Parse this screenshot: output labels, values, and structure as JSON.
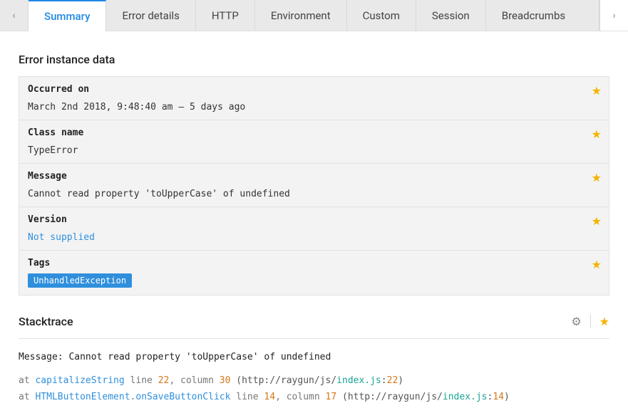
{
  "tabs": {
    "items": [
      {
        "label": "Summary",
        "active": true
      },
      {
        "label": "Error details",
        "active": false
      },
      {
        "label": "HTTP",
        "active": false
      },
      {
        "label": "Environment",
        "active": false
      },
      {
        "label": "Custom",
        "active": false
      },
      {
        "label": "Session",
        "active": false
      },
      {
        "label": "Breadcrumbs",
        "active": false
      }
    ]
  },
  "section_title": "Error instance data",
  "rows": {
    "occurred": {
      "label": "Occurred on",
      "value": "March 2nd 2018, 9:48:40 am – 5 days ago"
    },
    "classname": {
      "label": "Class name",
      "value": "TypeError"
    },
    "message": {
      "label": "Message",
      "value": "Cannot read property 'toUpperCase' of undefined"
    },
    "version": {
      "label": "Version",
      "value": "Not supplied",
      "is_link": true
    },
    "tags": {
      "label": "Tags",
      "tag": "UnhandledException"
    }
  },
  "stack": {
    "title": "Stacktrace",
    "message_label": "Message:",
    "message": "Cannot read property 'toUpperCase' of undefined",
    "frames": [
      {
        "at": "at",
        "fn": "capitalizeString",
        "line_kw": "line",
        "line": "22",
        "comma": ",",
        "col_kw": "column",
        "col": "30",
        "lp": "(",
        "url": "http://raygun/js/",
        "file": "index.js",
        "sep": ":",
        "filenum": "22",
        "rp": ")"
      },
      {
        "at": "at",
        "cls": "HTMLButtonElement",
        "dot": ".",
        "fn": "onSaveButtonClick",
        "line_kw": "line",
        "line": "14",
        "comma": ",",
        "col_kw": "column",
        "col": "17",
        "lp": "(",
        "url": "http://raygun/js/",
        "file": "index.js",
        "sep": ":",
        "filenum": "14",
        "rp": ")"
      }
    ]
  }
}
